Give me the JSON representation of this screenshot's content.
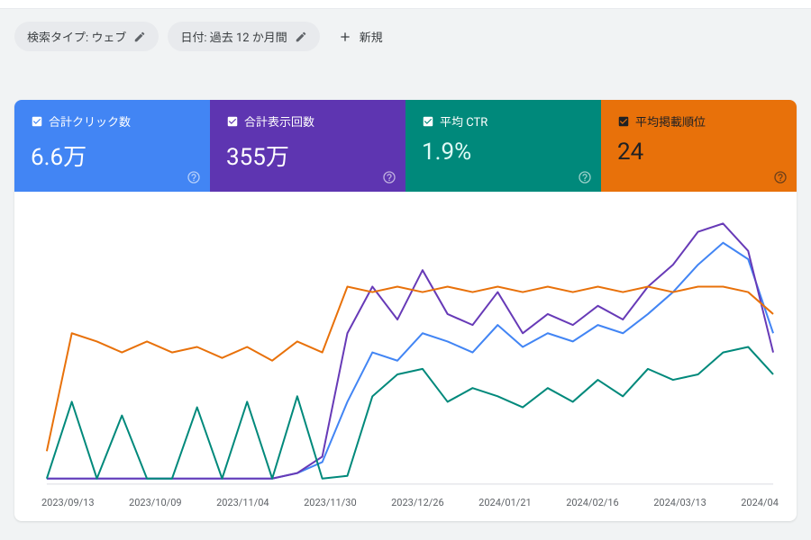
{
  "filters": {
    "search_type": "検索タイプ: ウェブ",
    "date_range": "日付: 過去 12 か月間",
    "new_label": "新規"
  },
  "metrics": {
    "clicks": {
      "label": "合計クリック数",
      "value": "6.6万"
    },
    "impressions": {
      "label": "合計表示回数",
      "value": "355万"
    },
    "ctr": {
      "label": "平均 CTR",
      "value": "1.9%"
    },
    "position": {
      "label": "平均掲載順位",
      "value": "24"
    }
  },
  "chart_data": {
    "type": "line",
    "x_ticks": [
      "2023/09/13",
      "2023/10/09",
      "2023/11/04",
      "2023/11/30",
      "2023/12/26",
      "2024/01/21",
      "2024/02/16",
      "2024/03/13",
      "2024/04"
    ],
    "note": "four overlaid normalized-percentage time series (clicks=blue, impressions=purple, ctr=teal, position=orange); values are approximate 0-100 percentages read from the chart shape",
    "categories": [
      "2023-09-13",
      "2023-09-20",
      "2023-09-27",
      "2023-10-04",
      "2023-10-11",
      "2023-10-18",
      "2023-10-25",
      "2023-11-01",
      "2023-11-08",
      "2023-11-15",
      "2023-11-22",
      "2023-11-29",
      "2023-12-06",
      "2023-12-13",
      "2023-12-20",
      "2023-12-27",
      "2024-01-03",
      "2024-01-10",
      "2024-01-17",
      "2024-01-24",
      "2024-01-31",
      "2024-02-07",
      "2024-02-14",
      "2024-02-21",
      "2024-02-28",
      "2024-03-06",
      "2024-03-13",
      "2024-03-20",
      "2024-03-27",
      "2024-04-03"
    ],
    "series": [
      {
        "name": "clicks",
        "color": "#4285f4",
        "values": [
          2,
          2,
          2,
          2,
          2,
          2,
          2,
          2,
          2,
          2,
          4,
          8,
          30,
          48,
          45,
          55,
          52,
          48,
          58,
          50,
          55,
          52,
          58,
          55,
          62,
          70,
          80,
          88,
          82,
          55
        ]
      },
      {
        "name": "impressions",
        "color": "#673ab7",
        "values": [
          2,
          2,
          2,
          2,
          2,
          2,
          2,
          2,
          2,
          2,
          4,
          10,
          55,
          72,
          60,
          78,
          62,
          58,
          70,
          55,
          62,
          58,
          65,
          60,
          72,
          80,
          92,
          95,
          85,
          48
        ]
      },
      {
        "name": "ctr",
        "color": "#00897b",
        "values": [
          2,
          30,
          2,
          25,
          2,
          2,
          28,
          2,
          30,
          2,
          32,
          2,
          3,
          32,
          40,
          42,
          30,
          35,
          32,
          28,
          35,
          30,
          38,
          32,
          42,
          38,
          40,
          48,
          50,
          40
        ]
      },
      {
        "name": "position",
        "color": "#e8710a",
        "values": [
          12,
          55,
          52,
          48,
          52,
          48,
          50,
          46,
          50,
          45,
          52,
          48,
          72,
          70,
          72,
          70,
          72,
          70,
          72,
          70,
          72,
          70,
          72,
          70,
          72,
          70,
          72,
          72,
          70,
          62
        ]
      }
    ],
    "ylim": [
      0,
      100
    ],
    "legend": [
      "合計クリック数",
      "合計表示回数",
      "平均 CTR",
      "平均掲載順位"
    ]
  }
}
